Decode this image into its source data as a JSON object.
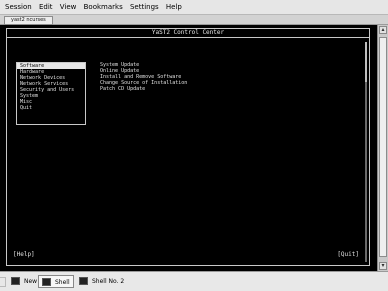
{
  "menubar": {
    "items": [
      "Session",
      "Edit",
      "View",
      "Bookmarks",
      "Settings",
      "Help"
    ]
  },
  "window": {
    "tab_title": "yast2 ncurses"
  },
  "dialog": {
    "title": "YaST2 Control Center",
    "categories": [
      {
        "label": "Software",
        "selected": true
      },
      {
        "label": "Hardware",
        "selected": false
      },
      {
        "label": "Network Devices",
        "selected": false
      },
      {
        "label": "Network Services",
        "selected": false
      },
      {
        "label": "Security and Users",
        "selected": false
      },
      {
        "label": "System",
        "selected": false
      },
      {
        "label": "Misc",
        "selected": false
      },
      {
        "label": "Quit",
        "selected": false
      }
    ],
    "actions": [
      "System Update",
      "Online Update",
      "Install and Remove Software",
      "Change Source of Installation",
      "Patch CD Update"
    ],
    "help_label": "[Help]",
    "quit_label": "[Quit]"
  },
  "taskbar": {
    "tabs": [
      {
        "label": "New",
        "active": false
      },
      {
        "label": "Shell",
        "active": true
      },
      {
        "label": "Shell No. 2",
        "active": false
      }
    ]
  }
}
